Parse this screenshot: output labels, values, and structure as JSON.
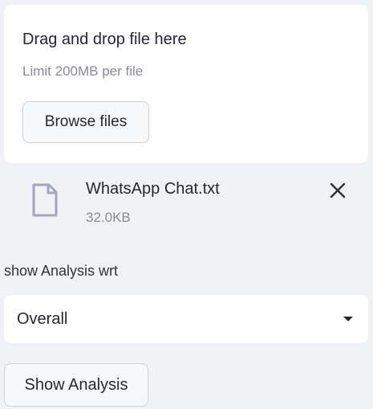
{
  "uploader": {
    "drop_title": "Drag and drop file here",
    "limit_text": "Limit 200MB per file",
    "browse_label": "Browse files"
  },
  "uploaded_file": {
    "icon": "file-icon",
    "name": "WhatsApp Chat.txt",
    "size": "32.0KB",
    "remove_icon": "close-icon"
  },
  "analysis_select": {
    "label": "show Analysis wrt",
    "selected": "Overall",
    "caret_icon": "caret-down-icon"
  },
  "show_button": {
    "label": "Show Analysis"
  },
  "colors": {
    "page_background": "#f0f2f6",
    "card_background": "#ffffff",
    "icon_color": "#a3a8b8",
    "muted_text": "#8a8c96"
  }
}
